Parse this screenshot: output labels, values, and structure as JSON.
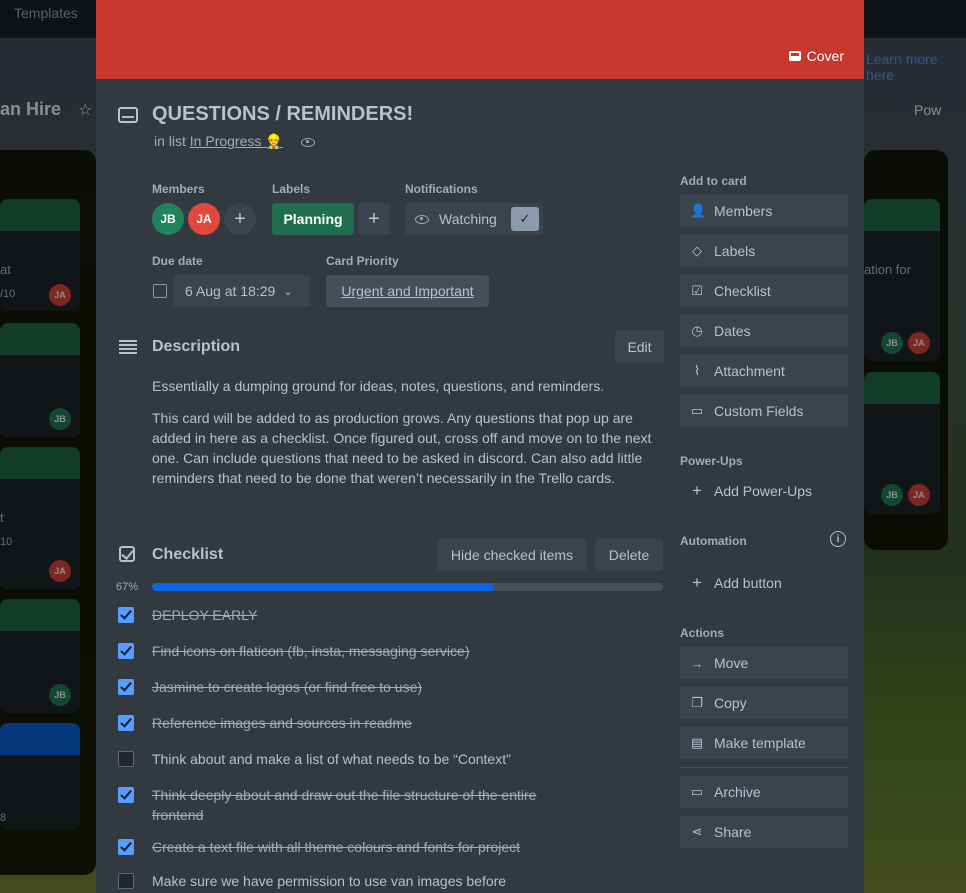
{
  "background": {
    "templates_label": "Templates",
    "learn_more": "Learn more here",
    "board_title": "an Hire",
    "power_label": "Pow",
    "left_cards": [
      {
        "text": "at",
        "counter": "/10",
        "avatar": "JA"
      },
      {
        "avatar": "JB"
      },
      {
        "text": "t",
        "counter": "10",
        "avatar": "JA"
      },
      {
        "avatar": "JB"
      },
      {
        "counter": "8"
      }
    ],
    "right_cards": [
      {
        "text": "ation for",
        "avatars": [
          "JB",
          "JA"
        ]
      },
      {
        "avatars": [
          "JB",
          "JA"
        ]
      }
    ]
  },
  "modal": {
    "cover_label": "Cover",
    "title": "QUESTIONS / REMINDERS!",
    "in_list_prefix": "in list",
    "list_name": "In Progress 👷",
    "members_label": "Members",
    "members": [
      {
        "initials": "JB",
        "color": "#1f845a"
      },
      {
        "initials": "JA",
        "color": "#e2483d"
      }
    ],
    "labels_label": "Labels",
    "labels": [
      {
        "name": "Planning",
        "color": "#216e4e"
      }
    ],
    "notifications_label": "Notifications",
    "watching_label": "Watching",
    "due_date_label": "Due date",
    "due_date_value": "6 Aug at 18:29",
    "priority_label": "Card Priority",
    "priority_value": "Urgent and Important",
    "description_title": "Description",
    "edit_label": "Edit",
    "description_p1": "Essentially a dumping ground for ideas, notes, questions, and reminders.",
    "description_p2": "This card will be added to as production grows. Any questions that pop up are added in here as a checklist. Once figured out, cross off and move on to the next one. Can include questions that need to be asked in discord. Can also add little reminders that need to be done that weren’t necessarily in the Trello cards.",
    "checklist_title": "Checklist",
    "hide_checked_label": "Hide checked items",
    "delete_label": "Delete",
    "progress_text": "67%",
    "progress_value": 0.67,
    "checklist_items": [
      {
        "text": "DEPLOY EARLY",
        "checked": true
      },
      {
        "text": "Find icons on flaticon (fb, insta, messaging service)",
        "checked": true
      },
      {
        "text": "Jasmine to create logos (or find free to use)",
        "checked": true
      },
      {
        "text": "Reference images and sources in readme",
        "checked": true
      },
      {
        "text": "Think about and make a list of what needs to be “Context”",
        "checked": false
      },
      {
        "text": "Think deeply about and draw out the file structure of the entire frontend",
        "checked": true
      },
      {
        "text": "Create a text file with all theme colours and fonts for project",
        "checked": true
      },
      {
        "text": "Make sure we have permission to use van images before",
        "checked": false
      }
    ],
    "sidebar": {
      "add_to_card_label": "Add to card",
      "add_to_card": [
        {
          "label": "Members",
          "icon": "person-icon"
        },
        {
          "label": "Labels",
          "icon": "tag-icon"
        },
        {
          "label": "Checklist",
          "icon": "checklist-icon"
        },
        {
          "label": "Dates",
          "icon": "clock-icon"
        },
        {
          "label": "Attachment",
          "icon": "paperclip-icon"
        },
        {
          "label": "Custom Fields",
          "icon": "custom-fields-icon"
        }
      ],
      "power_ups_label": "Power-Ups",
      "add_power_ups": "Add Power-Ups",
      "automation_label": "Automation",
      "add_button": "Add button",
      "actions_label": "Actions",
      "actions": [
        {
          "label": "Move",
          "icon": "arrow-right-icon"
        },
        {
          "label": "Copy",
          "icon": "copy-icon"
        },
        {
          "label": "Make template",
          "icon": "template-icon"
        }
      ],
      "actions2": [
        {
          "label": "Archive",
          "icon": "archive-icon"
        },
        {
          "label": "Share",
          "icon": "share-icon"
        }
      ]
    }
  }
}
